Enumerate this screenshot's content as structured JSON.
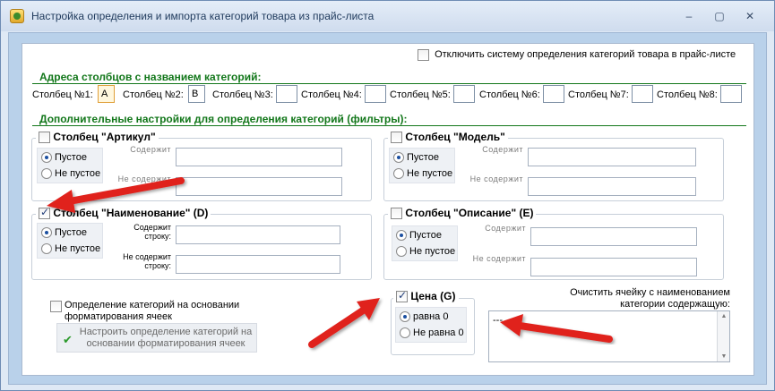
{
  "window": {
    "title": "Настройка определения и импорта категорий товара из прайс-листа",
    "controls": {
      "minimize": "–",
      "maximize": "▢",
      "close": "✕"
    }
  },
  "disable_system": {
    "label": "Отключить систему определения категорий товара в прайс-листе",
    "checked": false
  },
  "addresses": {
    "heading": "Адреса столбцов с названием категорий:",
    "columns": [
      {
        "label": "Столбец №1:",
        "value": "A"
      },
      {
        "label": "Столбец №2:",
        "value": "B"
      },
      {
        "label": "Столбец №3:",
        "value": ""
      },
      {
        "label": "Столбец №4:",
        "value": ""
      },
      {
        "label": "Столбец №5:",
        "value": ""
      },
      {
        "label": "Столбец №6:",
        "value": ""
      },
      {
        "label": "Столбец №7:",
        "value": ""
      },
      {
        "label": "Столбец №8:",
        "value": ""
      }
    ]
  },
  "filters": {
    "heading": "Дополнительные настройки для определения категорий (фильтры):",
    "article": {
      "title": "Столбец \"Артикул\"",
      "checked": false,
      "opt_empty": "Пустое",
      "opt_not_empty": "Не пустое",
      "contains_label": "Содержит",
      "not_contains_label": "Не содержит"
    },
    "model": {
      "title": "Столбец \"Модель\"",
      "checked": false,
      "opt_empty": "Пустое",
      "opt_not_empty": "Не пустое",
      "contains_label": "Содержит",
      "not_contains_label": "Не содержит"
    },
    "name": {
      "title": "Столбец \"Наименование\" (D)",
      "checked": true,
      "opt_empty": "Пустое",
      "opt_not_empty": "Не пустое",
      "contains_label_1": "Содержит",
      "contains_label_2": "строку:",
      "not_contains_label_1": "Не содержит",
      "not_contains_label_2": "строку:"
    },
    "description": {
      "title": "Столбец \"Описание\" (E)",
      "checked": false,
      "opt_empty": "Пустое",
      "opt_not_empty": "Не пустое",
      "contains_label": "Содержит",
      "not_contains_label": "Не содержит"
    },
    "price": {
      "title": "Цена (G)",
      "checked": true,
      "opt_zero": "равна 0",
      "opt_not_zero": "Не равна 0"
    }
  },
  "formatting": {
    "checkbox_line1": "Определение категорий на основании",
    "checkbox_line2": "форматирования ячеек",
    "button_line1": "Настроить определение категорий на",
    "button_line2": "основании форматирования ячеек"
  },
  "clear_cell": {
    "label_line1": "Очистить ячейку с наименованием",
    "label_line2": "категории содержащую:",
    "value": "---"
  },
  "colors": {
    "section_green": "#12771a",
    "annotation_red": "#e0201c"
  }
}
